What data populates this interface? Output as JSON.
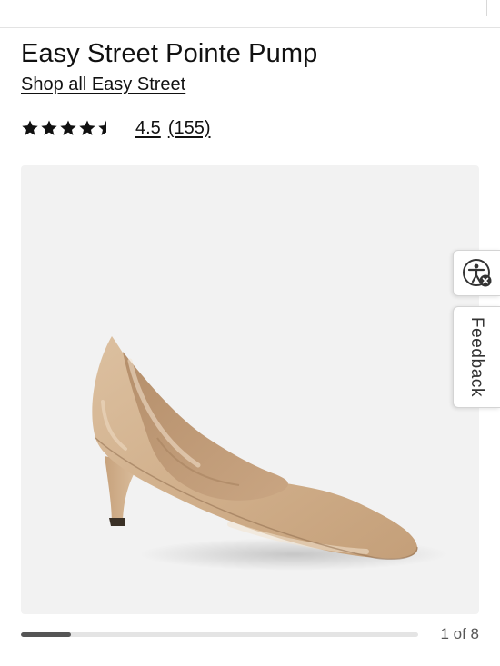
{
  "product": {
    "title": "Easy Street Pointe Pump",
    "brand_link": "Shop all Easy Street",
    "rating_value": "4.5",
    "review_count": "(155)",
    "rating": 4.5,
    "rating_max": 5
  },
  "image": {
    "subject": "nude patent pointed-toe pump",
    "accent_color": "#d8b895"
  },
  "widgets": {
    "accessibility_icon": "accessibility-icon",
    "feedback_label": "Feedback"
  },
  "carousel": {
    "counter": "1 of 8",
    "current": 1,
    "total": 8,
    "progress_fraction": 0.125
  }
}
